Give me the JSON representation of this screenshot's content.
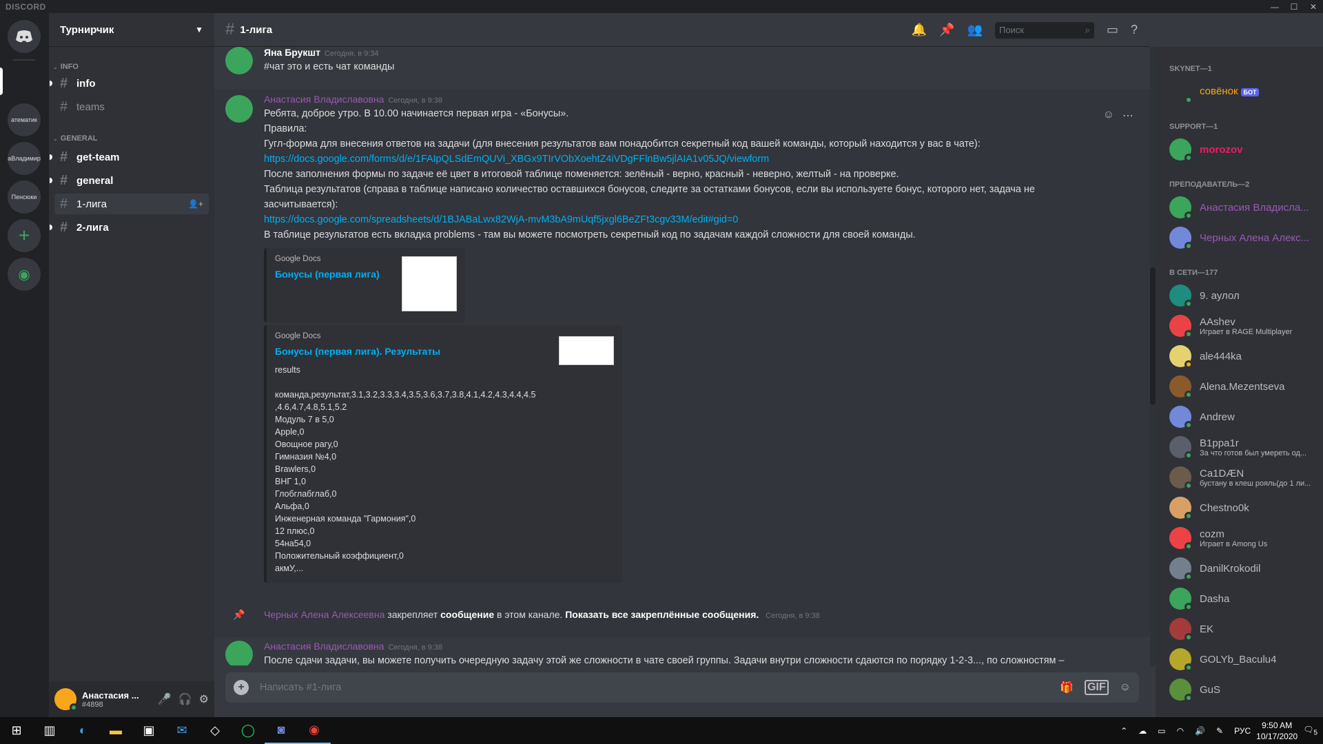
{
  "app": {
    "brand": "DISCORD"
  },
  "guilds": [
    {
      "label": "атематик"
    },
    {
      "label": "аВладимир"
    },
    {
      "label": "Пенсюки"
    }
  ],
  "server": {
    "name": "Турнирчик",
    "categories": [
      {
        "name": "INFO",
        "channels": [
          {
            "name": "info"
          },
          {
            "name": "teams"
          }
        ]
      },
      {
        "name": "GENERAL",
        "channels": [
          {
            "name": "get-team"
          },
          {
            "name": "general"
          },
          {
            "name": "1-лига"
          },
          {
            "name": "2-лига"
          }
        ]
      }
    ]
  },
  "user": {
    "name": "Анастасия ...",
    "tag": "#4898"
  },
  "channel": {
    "title": "1-лига",
    "search_placeholder": "Поиск"
  },
  "messages": [
    {
      "author": "Яна Брукшт",
      "time": "Сегодня, в 9:34",
      "text": "#чат это и есть чат команды"
    },
    {
      "author": "Анастасия Владиславовна",
      "time": "Сегодня, в 9:38",
      "lines": [
        "Ребята, доброе утро. В 10.00 начинается первая игра - «Бонусы».",
        "Правила:",
        "Гугл-форма для внесения ответов на задачи (для внесения результатов вам понадобится секретный код вашей команды, который находится у вас в чате):"
      ],
      "link1": "https://docs.google.com/forms/d/e/1FAIpQLSdEmQUVi_XBGx9TIrVObXoehtZ4iVDgFFlnBw5jlAIA1v05JQ/viewform",
      "line4": "После заполнения формы по задаче её цвет в итоговой таблице поменяется: зелёный - верно, красный - неверно, желтый - на проверке.",
      "line5": "Таблица результатов (справа в таблице написано количество оставшихся бонусов, следите за остатками бонусов, если вы используете бонус, которого нет, задача не засчитывается):",
      "link2": "https://docs.google.com/spreadsheets/d/1BJABaLwx82WjA-mvM3bA9mUqf5jxgl6BeZFt3cgv33M/edit#gid=0",
      "line6": "В таблице результатов есть вкладка problems - там вы можете посмотреть секретный код по задачам каждой сложности для своей команды.",
      "embed1": {
        "provider": "Google Docs",
        "title": "Бонусы (первая лига)"
      },
      "embed2": {
        "provider": "Google Docs",
        "title": "Бонусы (первая лига). Результаты",
        "desc": "results\n\nкоманда,результат,3.1,3.2,3.3,3.4,3.5,3.6,3.7,3.8,4.1,4.2,4.3,4.4,4.5\n,4.6,4.7,4.8,5.1,5.2\nМодуль 7 в 5,0\nApple,0\nОвощное рагу,0\nГимназия №4,0\nBrawlers,0\nВНГ 1,0\nГлобглабглаб,0\nАльфа,0\nИнженерная команда \"Гармония\",0\n12 плюс,0\n54на54,0\nПоложительный коэффициент,0\nакмУ,..."
      }
    }
  ],
  "system_message": {
    "author": "Черных Алена Алексеевна",
    "action": "закрепляет",
    "object": "сообщение",
    "middle": "в этом канале.",
    "show_all": "Показать все закреплённые сообщения.",
    "time": "Сегодня, в 9:38"
  },
  "last_message": {
    "author": "Анастасия Владиславовна",
    "time": "Сегодня, в 9:38",
    "text": "После сдачи задачи, вы можете получить очередную задачу этой же сложности в чате своей группы. Задачи внутри сложности сдаются по порядку 1-2-3..., по сложностям –"
  },
  "composer": {
    "placeholder": "Написать #1-лига",
    "gif": "GIF"
  },
  "members": {
    "groups": [
      {
        "title": "SKYNET—1",
        "items": [
          {
            "name": "совёнок",
            "badge": "БОТ",
            "color": "#faa61a"
          }
        ]
      },
      {
        "title": "SUPPORT—1",
        "items": [
          {
            "name": "morozov",
            "color": "#e91e63"
          }
        ]
      },
      {
        "title": "ПРЕПОДАВАТЕЛЬ—2",
        "items": [
          {
            "name": "Анастасия Владисла...",
            "color": "#9b59b6"
          },
          {
            "name": "Черных Алена Алекс...",
            "color": "#9b59b6"
          }
        ]
      },
      {
        "title": "В СЕТИ—177",
        "items": [
          {
            "name": "9. аулол"
          },
          {
            "name": "AAshev",
            "activity": "Играет в RAGE Multiplayer"
          },
          {
            "name": "ale444ka"
          },
          {
            "name": "Alena.Mezentseva"
          },
          {
            "name": "Andrew"
          },
          {
            "name": "B1ppa1r",
            "activity": "За что готов был умереть од..."
          },
          {
            "name": "Ca1DÆN",
            "activity": "бустану в клеш рояль(до 1 ли..."
          },
          {
            "name": "Chestno0k"
          },
          {
            "name": "cozm",
            "activity": "Играет в Among Us"
          },
          {
            "name": "DanilKrokodil"
          },
          {
            "name": "Dasha"
          },
          {
            "name": "EK"
          },
          {
            "name": "GOLYb_Baculu4"
          },
          {
            "name": "GuS"
          }
        ]
      }
    ]
  },
  "taskbar": {
    "lang": "РУС",
    "time": "9:50 AM",
    "date": "10/17/2020",
    "notif": "5"
  }
}
